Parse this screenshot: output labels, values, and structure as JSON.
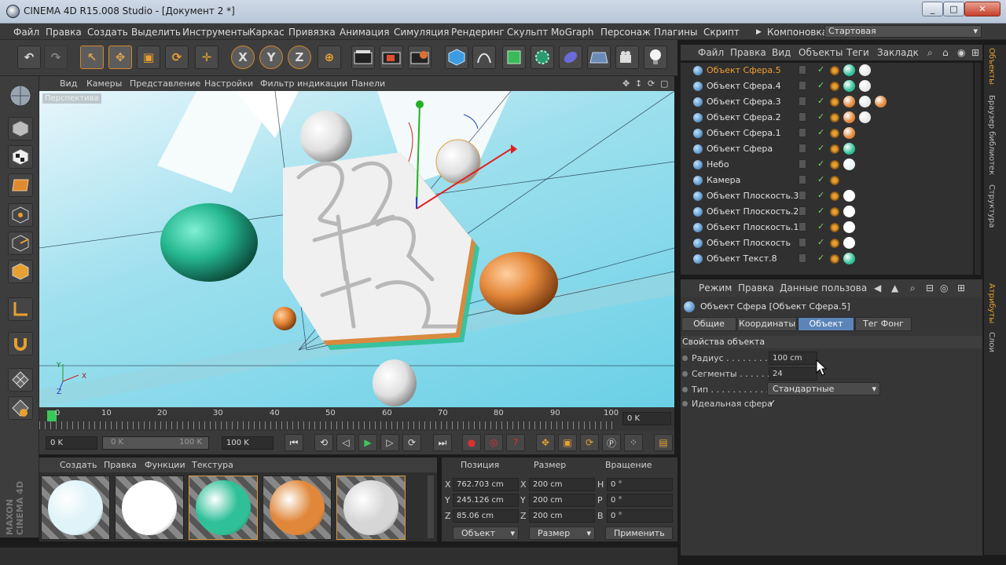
{
  "window": {
    "title": "CINEMA 4D R15.008 Studio - [Документ 2 *]",
    "min": "_",
    "max": "□",
    "close": "✕"
  },
  "menu": {
    "items": [
      "Файл",
      "Правка",
      "Создать",
      "Выделить",
      "Инструменты",
      "Каркас",
      "Привязка",
      "Анимация",
      "Симуляция",
      "Рендеринг",
      "Скульпт",
      "MoGraph",
      "Персонаж",
      "Плагины",
      "Скрипт",
      "Компоновка"
    ],
    "layout_label": "Стартовая"
  },
  "toolbar": {
    "undo": "↶",
    "redo": "↷",
    "select": "↖",
    "move": "✥",
    "scale": "▣",
    "rotate": "⟳",
    "last": "✛",
    "x": "X",
    "y": "Y",
    "z": "Z",
    "world": "⊕"
  },
  "viewport": {
    "menu": [
      "Вид",
      "Камеры",
      "Представление",
      "Настройки",
      "Фильтр индикации",
      "Панели"
    ],
    "label": "Перспектива",
    "axis_x": "X",
    "axis_y": "Y",
    "axis_z": "Z"
  },
  "timeline": {
    "ticks": [
      "0",
      "10",
      "20",
      "30",
      "40",
      "50",
      "60",
      "70",
      "80",
      "90",
      "100"
    ],
    "frame_display": "0 K",
    "start": "0 K",
    "range_start": "0 K",
    "range_end": "100 K",
    "end": "100 K"
  },
  "materials": {
    "menu": [
      "Создать",
      "Правка",
      "Функции",
      "Текстура"
    ],
    "swatches": [
      "#dff3f8",
      "#ffffff",
      "#2fc097",
      "#e0873a",
      "#d6d6d6"
    ]
  },
  "coords": {
    "headers": [
      "Позиция",
      "Размер",
      "Вращение"
    ],
    "rows": [
      {
        "axis": "X",
        "pos": "762.703 cm",
        "size_axis": "X",
        "size": "200 cm",
        "rot_axis": "H",
        "rot": "0 °"
      },
      {
        "axis": "Y",
        "pos": "245.126 cm",
        "size_axis": "Y",
        "size": "200 cm",
        "rot_axis": "P",
        "rot": "0 °"
      },
      {
        "axis": "Z",
        "pos": "85.06 cm",
        "size_axis": "Z",
        "size": "200 cm",
        "rot_axis": "B",
        "rot": "0 °"
      }
    ],
    "mode1": "Объект",
    "mode2": "Размер",
    "apply": "Применить"
  },
  "objects": {
    "menu": [
      "Файл",
      "Правка",
      "Вид",
      "Объекты",
      "Теги",
      "Закладк"
    ],
    "items": [
      {
        "name": "Объект Сфера.5",
        "selected": true,
        "tags": [
          "#2fc097",
          "#e8e8e8"
        ]
      },
      {
        "name": "Объект Сфера.4",
        "selected": false,
        "tags": [
          "#2fc097",
          "#e8e8e8"
        ]
      },
      {
        "name": "Объект Сфера.3",
        "selected": false,
        "tags": [
          "#e0873a",
          "#e8e8e8",
          "#e0873a"
        ]
      },
      {
        "name": "Объект Сфера.2",
        "selected": false,
        "tags": [
          "#e0873a",
          "#e8e8e8"
        ]
      },
      {
        "name": "Объект Сфера.1",
        "selected": false,
        "tags": [
          "#e0873a"
        ]
      },
      {
        "name": "Объект Сфера",
        "selected": false,
        "tags": [
          "#2fc097"
        ]
      },
      {
        "name": "Небо",
        "selected": false,
        "tags": [
          "#e6f3f6"
        ]
      },
      {
        "name": "Камера",
        "selected": false,
        "tags": []
      },
      {
        "name": "Объект Плоскость.3",
        "selected": false,
        "tags": [
          "#ffffff"
        ]
      },
      {
        "name": "Объект Плоскость.2",
        "selected": false,
        "tags": [
          "#ffffff"
        ]
      },
      {
        "name": "Объект Плоскость.1",
        "selected": false,
        "tags": [
          "#ffffff"
        ]
      },
      {
        "name": "Объект Плоскость",
        "selected": false,
        "tags": [
          "#ffffff"
        ]
      },
      {
        "name": "Объект Текст.8",
        "selected": false,
        "tags": [
          "#2fc097"
        ]
      }
    ]
  },
  "attributes": {
    "menu": [
      "Режим",
      "Правка",
      "Данные пользова"
    ],
    "title": "Объект Сфера [Объект Сфера.5]",
    "tabs": [
      "Общие",
      "Координаты",
      "Объект",
      "Тег Фонг"
    ],
    "section": "Свойства объекта",
    "radius_label": "Радиус . . . . . . . .",
    "radius": "100 cm",
    "segments_label": "Сегменты . . . . . .",
    "segments": "24",
    "type_label": "Тип . . . . . . . . . . . .",
    "type": "Стандартные",
    "perfect_label": "Идеальная сфера",
    "perfect": "✓"
  },
  "sidetabs": [
    "Объекты",
    "Браузер библиотек",
    "Структура",
    "Атрибуты",
    "Слои"
  ],
  "maxon": "MAXON CINEMA 4D"
}
